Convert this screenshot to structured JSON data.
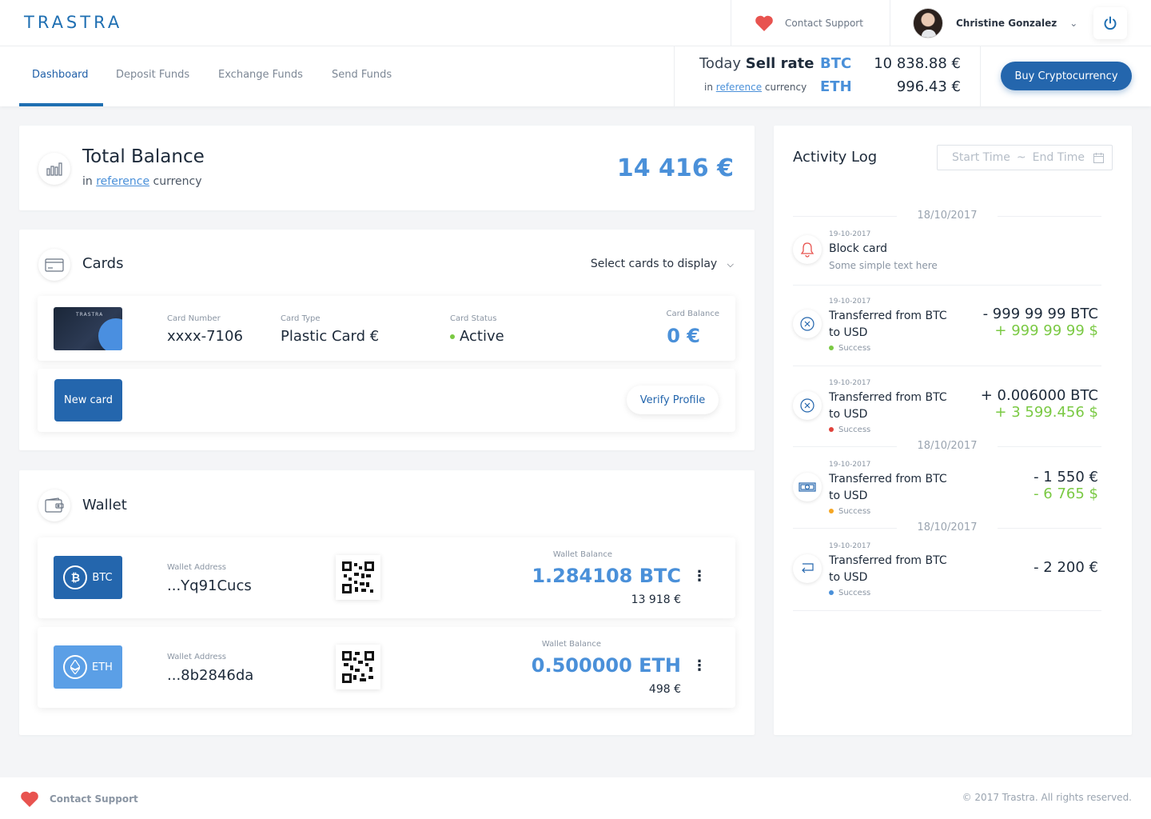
{
  "header": {
    "logo": "TRASTRA",
    "contact_support": "Contact Support",
    "user_name": "Christine Gonzalez"
  },
  "nav": {
    "tabs": [
      "Dashboard",
      "Deposit Funds",
      "Exchange Funds",
      "Send Funds"
    ],
    "active_tab": "Dashboard",
    "rates": {
      "today": "Today",
      "sell_rate": "Sell rate",
      "in": "in",
      "reference": "reference",
      "currency": "currency",
      "btc_label": "BTC",
      "btc_value": "10 838.88 €",
      "eth_label": "ETH",
      "eth_value": "996.43 €"
    },
    "buy_button": "Buy Cryptocurrency"
  },
  "balance": {
    "title": "Total Balance",
    "in": "in",
    "reference": "reference",
    "currency": "currency",
    "value": "14 416 €"
  },
  "cards": {
    "title": "Cards",
    "select_label": "Select cards to display",
    "card_brand": "TRASTRA",
    "card_number_label": "Card Number",
    "card_number": "xxxx-7106",
    "card_type_label": "Card Type",
    "card_type": "Plastic Card €",
    "card_status_label": "Card Status",
    "card_status": "Active",
    "card_balance_label": "Card Balance",
    "card_balance": "0 €",
    "new_card": "New card",
    "verify_profile": "Verify Profile"
  },
  "wallet": {
    "title": "Wallet",
    "items": [
      {
        "coin": "BTC",
        "address_label": "Wallet Address",
        "address": "...Yq91Cucs",
        "balance_label": "Wallet Balance",
        "balance": "1.284108 BTC",
        "fiat": "13 918 €",
        "color": "#2466ad"
      },
      {
        "coin": "ETH",
        "address_label": "Wallet Address",
        "address": "...8b2846da",
        "balance_label": "Wallet Balance",
        "balance": "0.500000 ETH",
        "fiat": "498 €",
        "color": "#5b9fe6"
      }
    ]
  },
  "activity": {
    "title": "Activity Log",
    "start_time": "Start Time",
    "range_sep": "~",
    "end_time": "End Time",
    "date1": "18/10/2017",
    "date2": "18/10/2017",
    "date3": "18/10/2017",
    "items": [
      {
        "time": "19-10-2017",
        "title": "Block card",
        "desc": "Some simple text here",
        "icon": "bell-icon"
      },
      {
        "time": "19-10-2017",
        "title": "Transferred from BTC to USD",
        "status": "Success",
        "status_color": "#7ac943",
        "amount1": "- 999 99 99 BTC",
        "amount2": "+ 999 99 99 $",
        "icon": "cancel-circle-icon"
      },
      {
        "time": "19-10-2017",
        "title": "Transferred from BTC to USD",
        "status": "Success",
        "status_color": "#e0423b",
        "amount1": "+ 0.006000 BTC",
        "amount2": "+ 3 599.456 $",
        "icon": "cancel-circle-icon"
      },
      {
        "time": "19-10-2017",
        "title": "Transferred from BTC to USD",
        "status": "Success",
        "status_color": "#f5a623",
        "amount1": "- 1 550 €",
        "amount2": "- 6 765 $",
        "icon": "banknote-icon"
      },
      {
        "time": "19-10-2017",
        "title": "Transferred from BTC to USD",
        "status": "Success",
        "status_color": "#4a90d9",
        "amount1": "- 2 200 €",
        "icon": "transfer-arrow-icon"
      }
    ]
  },
  "footer": {
    "contact_support": "Contact Support",
    "copyright": "© 2017 Trastra. All rights reserved."
  },
  "colors": {
    "accent": "#4a90d9",
    "primary": "#2466ad",
    "positive": "#7ac943",
    "heart": "#e8534f"
  }
}
